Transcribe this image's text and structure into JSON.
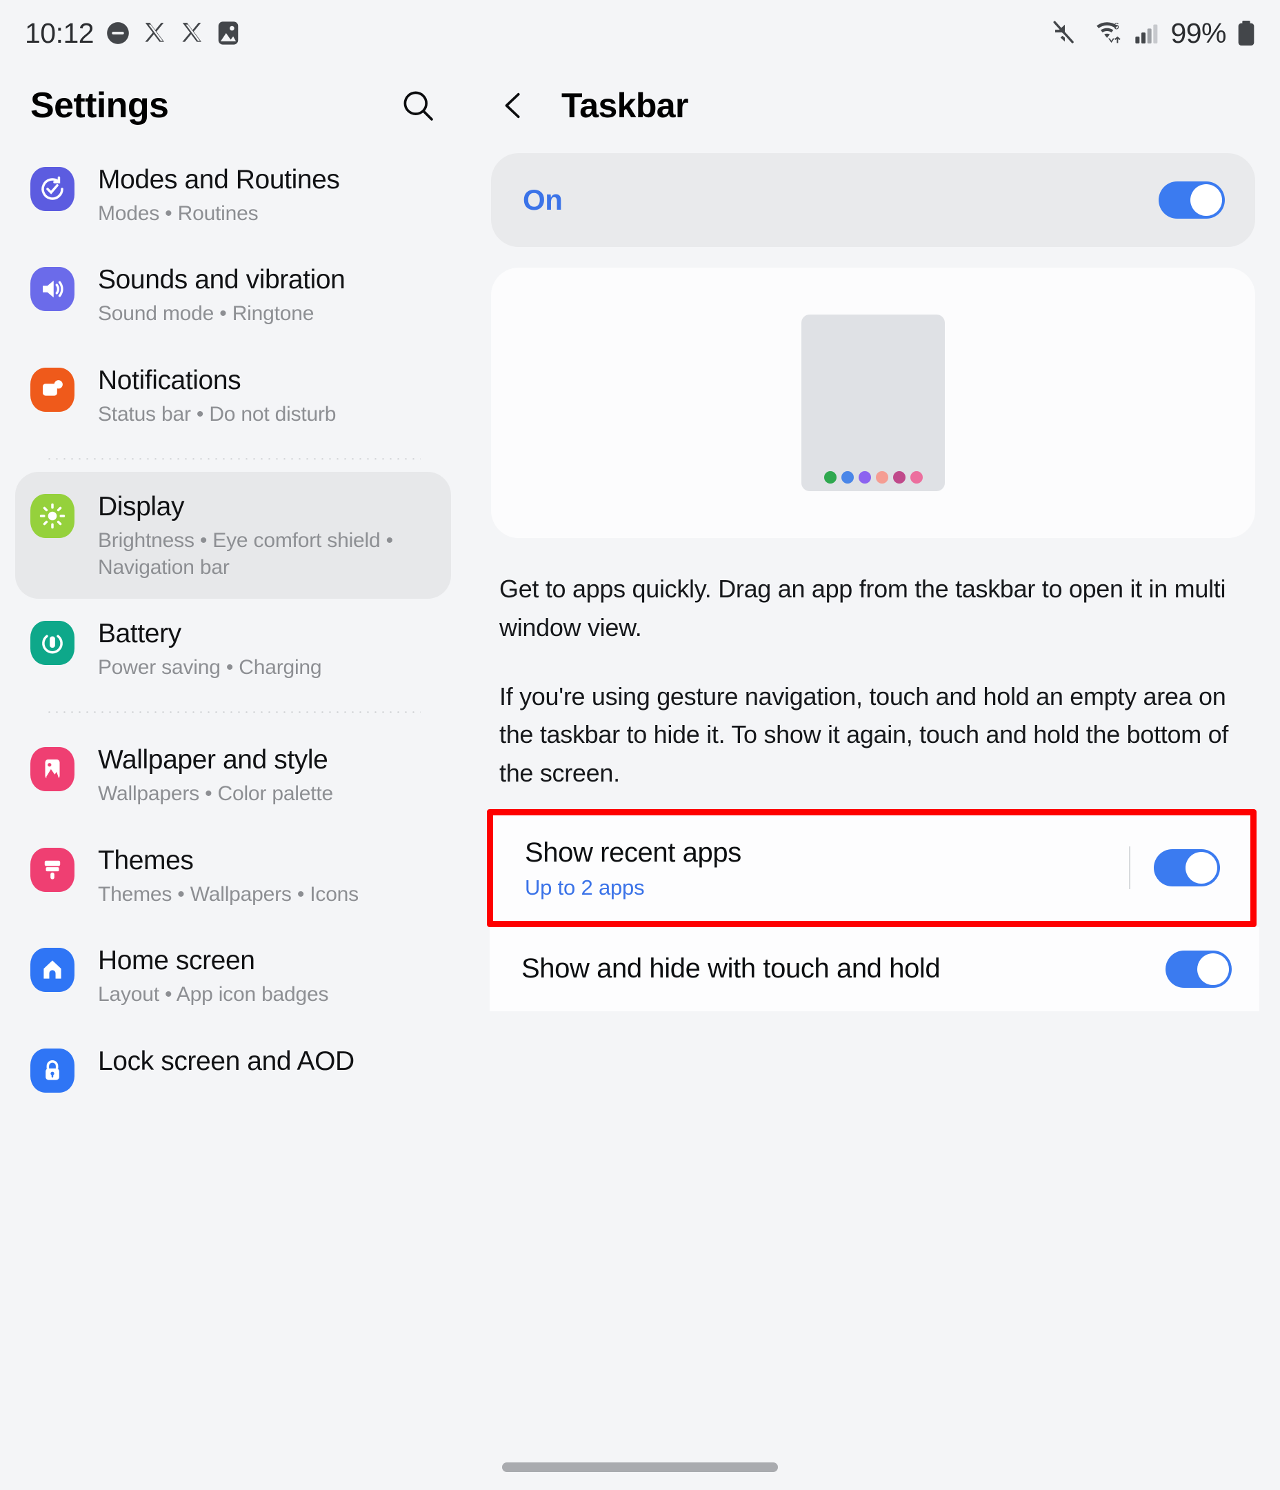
{
  "status_bar": {
    "time": "10:12",
    "battery_percent": "99%",
    "left_icons": [
      "do-not-disturb-icon",
      "x-app-icon",
      "x-app-icon",
      "gallery-icon"
    ],
    "right_icons": [
      "mute-icon",
      "wifi-6-icon",
      "signal-bars-icon",
      "battery-icon"
    ]
  },
  "sidebar": {
    "title": "Settings",
    "search_icon": "search-icon",
    "items": [
      {
        "label": "Modes and Routines",
        "sub": "Modes  •  Routines",
        "icon": "modes-routines-icon",
        "color": "#5c5ce0",
        "selected": false
      },
      {
        "label": "Sounds and vibration",
        "sub": "Sound mode  •  Ringtone",
        "icon": "sound-icon",
        "color": "#6b6bea",
        "selected": false
      },
      {
        "label": "Notifications",
        "sub": "Status bar  •  Do not disturb",
        "icon": "notifications-icon",
        "color": "#ef5a1b",
        "selected": false
      },
      {
        "label": "Display",
        "sub": "Brightness  •  Eye comfort shield  •  Navigation bar",
        "icon": "display-icon",
        "color": "#95d13c",
        "selected": true
      },
      {
        "label": "Battery",
        "sub": "Power saving  •  Charging",
        "icon": "battery-settings-icon",
        "color": "#0ea88a",
        "selected": false
      },
      {
        "label": "Wallpaper and style",
        "sub": "Wallpapers  •  Color palette",
        "icon": "wallpaper-icon",
        "color": "#ef3f72",
        "selected": false
      },
      {
        "label": "Themes",
        "sub": "Themes  •  Wallpapers  •  Icons",
        "icon": "themes-icon",
        "color": "#ef3f72",
        "selected": false
      },
      {
        "label": "Home screen",
        "sub": "Layout  •  App icon badges",
        "icon": "home-screen-icon",
        "color": "#2f75f5",
        "selected": false
      },
      {
        "label": "Lock screen and AOD",
        "sub": "",
        "icon": "lock-screen-icon",
        "color": "#2f75f5",
        "selected": false
      }
    ]
  },
  "detail": {
    "back_icon": "chevron-left-icon",
    "title": "Taskbar",
    "master_toggle": {
      "label": "On",
      "state": "on"
    },
    "illustration": {
      "name": "taskbar-preview-illustration",
      "dot_colors": [
        "#2fa84f",
        "#4a86e8",
        "#8c63f0",
        "#f59d93",
        "#c04a8b",
        "#ec6f9e"
      ]
    },
    "description_paragraphs": [
      "Get to apps quickly. Drag an app from the taskbar to open it in multi window view.",
      "If you're using gesture navigation, touch and hold an empty area on the taskbar to hide it. To show it again, touch and hold the bottom of the screen."
    ],
    "preferences": [
      {
        "title": "Show recent apps",
        "sub": "Up to 2 apps",
        "state": "on",
        "highlighted": true
      },
      {
        "title": "Show and hide with touch and hold",
        "sub": "",
        "state": "on",
        "highlighted": false
      }
    ]
  },
  "colors": {
    "accent_blue": "#3b7bf0",
    "highlight_red": "#fe0000",
    "page_bg": "#f4f5f7"
  }
}
